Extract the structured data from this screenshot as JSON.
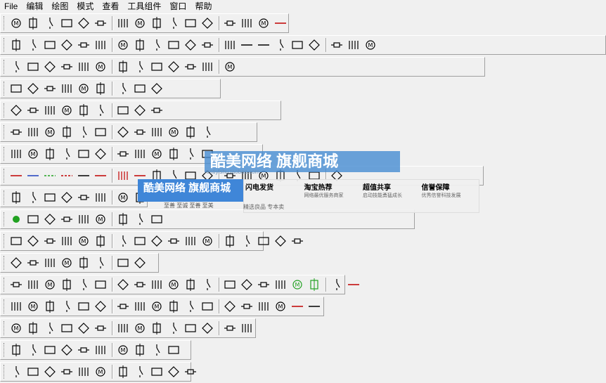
{
  "menu": [
    "File",
    "编辑",
    "绘图",
    "模式",
    "查看",
    "工具组件",
    "窗口",
    "帮助"
  ],
  "watermark": {
    "brand": "酷美网络 旗舰商城",
    "url": "rentiyishu.taobao.com",
    "tags": "至善 至诚    至善 至美",
    "items": [
      {
        "title": "闪电发货",
        "sub": ""
      },
      {
        "title": "淘宝热荐",
        "sub": "网络最优服务商家"
      },
      {
        "title": "超值共享",
        "sub": "启动技能勇猛成长"
      },
      {
        "title": "信誉保障",
        "sub": "优秀信誉科技发展"
      }
    ],
    "footer": "精选良品          专本卖"
  },
  "colors": {
    "accent_red": "#c00000",
    "accent_blue": "#1f3fbf",
    "accent_green": "#21a121",
    "icon": "#000000"
  },
  "toolbars": [
    [
      {
        "w": 411,
        "icons": [
          "lamp",
          "fuse",
          "switch",
          "lamp-holder",
          "plug",
          "fuse-box",
          "switch-spst",
          "switch-dpst",
          "diamond",
          "grounded-plug",
          "box-plug",
          "terminal",
          "cross-terminal",
          "io-box",
          "cross-box",
          "red-line"
        ]
      }
    ],
    [
      {
        "w": 862,
        "icons": [
          "single-pole",
          "neutral",
          "pe",
          "ln",
          "lnpe",
          "lll",
          "lllpe",
          "llln",
          "lllnpe",
          "lamp-socket",
          "lamp-socket-2",
          "double-lamp",
          "earth",
          "busbar",
          "busbar-2",
          "arrow-down",
          "diamond-plus",
          "motor-box",
          "motor-box-2",
          "capacitor",
          "target"
        ]
      }
    ],
    [
      {
        "w": 690,
        "icons": [
          "switch-1",
          "switch-2",
          "switch-3",
          "switch-4",
          "relay-1",
          "relay-2",
          "relay-3",
          "relay-4",
          "relay-5",
          "relay-6",
          "relay-7",
          "relay-8",
          "relay-9"
        ]
      }
    ],
    [
      {
        "w": 314,
        "icons": [
          "contact-1",
          "contact-2",
          "contact-3",
          "contact-4",
          "contact-5",
          "contact-6",
          "contact-7",
          "contact-8",
          "contact-9"
        ]
      }
    ],
    [
      {
        "w": 400,
        "icons": [
          "coil-1",
          "coil-2",
          "coil-3",
          "coil-4",
          "coil-5",
          "coil-6",
          "coil-7",
          "coil-8",
          "coil-9"
        ]
      }
    ],
    [
      {
        "w": 366,
        "icons": [
          "motor-1",
          "motor-2",
          "motor-3",
          "motor-4",
          "motor-5",
          "motor-6",
          "motor-7",
          "motor-8",
          "motor-9",
          "motor-10",
          "pump",
          "fan"
        ]
      }
    ],
    [
      {
        "w": 374,
        "icons": [
          "fuse-1",
          "fuse-2",
          "fuse-3",
          "diode",
          "cont-box",
          "box-1",
          "box-2",
          "meter",
          "arrow-box",
          "arrow-box-2",
          "arrow-box-3",
          "cont-box-2"
        ]
      }
    ],
    [
      {
        "w": 688,
        "icons": [
          "red-line",
          "blue-line",
          "green-dash",
          "red-dash",
          "black-line",
          "red-bar",
          "red-cross",
          "red-lines",
          "lamp-x",
          "lamp-y",
          "lamp-z",
          "lamp-w",
          "lamp-v",
          "lamp-u",
          "lamp-t",
          "lamp-s",
          "lamp-r",
          "plug-1",
          "plug-2"
        ]
      }
    ],
    [
      {
        "w": 210,
        "icons": [
          "nc-1",
          "nc-2",
          "nc-3",
          "nc-4",
          "nc-5",
          "nc-6",
          "nc-7",
          "nc-8"
        ]
      }
    ],
    [
      {
        "w": 590,
        "icons": [
          "green-star",
          "sw-1",
          "sw-2",
          "sw-3",
          "sw-4",
          "sw-5",
          "sw-6",
          "sw-7",
          "sw-8"
        ]
      }
    ],
    [
      {
        "w": 375,
        "icons": [
          "coil-a",
          "coil-b",
          "coil-c",
          "coil-d",
          "coil-e",
          "coil-f",
          "coil-g",
          "coil-h",
          "coil-i",
          "coil-j",
          "coil-k",
          "coil-l",
          "diamond-a",
          "diamond-b",
          "tri-a",
          "tri-b",
          "tri-c"
        ]
      }
    ],
    [
      {
        "w": 226,
        "icons": [
          "ssr-1",
          "ssr-2",
          "ssr-3",
          "ssr-4",
          "box-3",
          "box-4",
          "box-5",
          "box-6"
        ]
      }
    ],
    [
      {
        "w": 491,
        "icons": [
          "term-1",
          "term-2",
          "term-3",
          "term-4",
          "term-5",
          "term-6",
          "term-7",
          "term-8",
          "term-9",
          "term-10",
          "term-11",
          "term-12",
          "term-13",
          "term-14",
          "tri-box",
          "tri-box-2",
          "green-box",
          "green-box-2",
          "gray-box",
          "red-line-2"
        ]
      }
    ],
    [
      {
        "w": 461,
        "icons": [
          "cap-1",
          "cap-2",
          "cap-3",
          "cap-4",
          "cap-5",
          "cap-6",
          "cap-7",
          "term-15",
          "term-16",
          "term-17",
          "term-18",
          "term-19",
          "term-20",
          "term-21",
          "lamp-2",
          "lamp-3",
          "red-line-3",
          "line-4"
        ]
      }
    ],
    [
      {
        "w": 364,
        "icons": [
          "comp-1",
          "comp-2",
          "comp-3",
          "comp-4",
          "comp-5",
          "comp-6",
          "comp-7",
          "comp-8",
          "comp-9",
          "comp-10",
          "comp-11",
          "comp-12",
          "comp-13",
          "comp-14"
        ]
      }
    ],
    [
      {
        "w": 272,
        "icons": [
          "box-7",
          "box-8",
          "box-9",
          "box-10",
          "box-11",
          "box-12",
          "box-13",
          "box-14",
          "box-15",
          "box-16"
        ]
      }
    ],
    [
      {
        "w": 272,
        "icons": [
          "resistor",
          "res-2",
          "res-3",
          "res-4",
          "res-5",
          "res-6",
          "res-7",
          "res-8",
          "res-9",
          "res-10",
          "res-11"
        ]
      }
    ]
  ]
}
